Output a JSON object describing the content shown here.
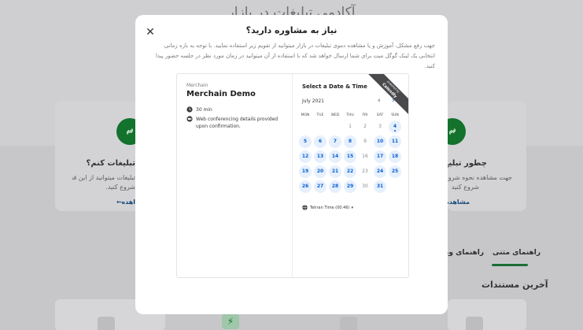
{
  "background": {
    "title": "آکادمی تبلیغات در بازار",
    "card_right": {
      "heading": "چطور تبلیغ",
      "desc1": "جهت مشاهده نحوه شروع تبلیغ",
      "desc2": "شروع کنید",
      "link": "مشاهده"
    },
    "card_left": {
      "heading": "تبلیغات کنم؟",
      "desc1": "تبلیغات میتوانید از این قسمت",
      "desc2": "شروع کنید.",
      "link": "اهده"
    },
    "tabs": [
      "راهنمای متنی",
      "راهنمای ویدیو"
    ],
    "section_title": "آخرین مستندات"
  },
  "modal": {
    "title": "نیاز به مشاوره دارید؟",
    "close_glyph": "✕",
    "description": "جهت رفع مشکل، آموزش و یا مشاهده دموی تبلیغات در بازار میتوانید از تقویم زیر استفاده نمایید. با توجه به بازه زمانی انتخابی یک لینک گوگل میت برای شما ارسال خواهد شد که با استفاده از آن میتوانید در زمان مورد نظر در جلسه حضور پیدا کنید."
  },
  "widget": {
    "organizer": "Merchain",
    "event_name": "Merchain Demo",
    "duration": "30 min",
    "conferencing": "Web conferencing details provided upon confirmation.",
    "heading": "Select a Date & Time",
    "month": "July 2021",
    "prev_glyph": "‹",
    "next_glyph": "›",
    "ribbon_top": "powered by",
    "ribbon_brand": "Calendly",
    "weekdays": [
      "MON",
      "TUE",
      "WED",
      "THU",
      "FRI",
      "SAT",
      "SUN"
    ],
    "weeks": [
      [
        {
          "d": ""
        },
        {
          "d": ""
        },
        {
          "d": ""
        },
        {
          "d": "1",
          "a": false
        },
        {
          "d": "2",
          "a": false
        },
        {
          "d": "3",
          "a": false
        },
        {
          "d": "4",
          "a": true,
          "today": true
        }
      ],
      [
        {
          "d": "5",
          "a": true
        },
        {
          "d": "6",
          "a": true
        },
        {
          "d": "7",
          "a": true
        },
        {
          "d": "8",
          "a": true
        },
        {
          "d": "9",
          "a": false
        },
        {
          "d": "10",
          "a": true
        },
        {
          "d": "11",
          "a": true
        }
      ],
      [
        {
          "d": "12",
          "a": true
        },
        {
          "d": "13",
          "a": true
        },
        {
          "d": "14",
          "a": true
        },
        {
          "d": "15",
          "a": true
        },
        {
          "d": "16",
          "a": false
        },
        {
          "d": "17",
          "a": true
        },
        {
          "d": "18",
          "a": true
        }
      ],
      [
        {
          "d": "19",
          "a": true
        },
        {
          "d": "20",
          "a": true
        },
        {
          "d": "21",
          "a": true
        },
        {
          "d": "22",
          "a": true
        },
        {
          "d": "23",
          "a": false
        },
        {
          "d": "24",
          "a": true
        },
        {
          "d": "25",
          "a": true
        }
      ],
      [
        {
          "d": "26",
          "a": true
        },
        {
          "d": "27",
          "a": true
        },
        {
          "d": "28",
          "a": true
        },
        {
          "d": "29",
          "a": true
        },
        {
          "d": "30",
          "a": false
        },
        {
          "d": "31",
          "a": true
        },
        {
          "d": ""
        }
      ]
    ],
    "timezone": "Tehran Time (00:46)",
    "timezone_caret": "▾",
    "accent_color": "#0a5fd0"
  }
}
